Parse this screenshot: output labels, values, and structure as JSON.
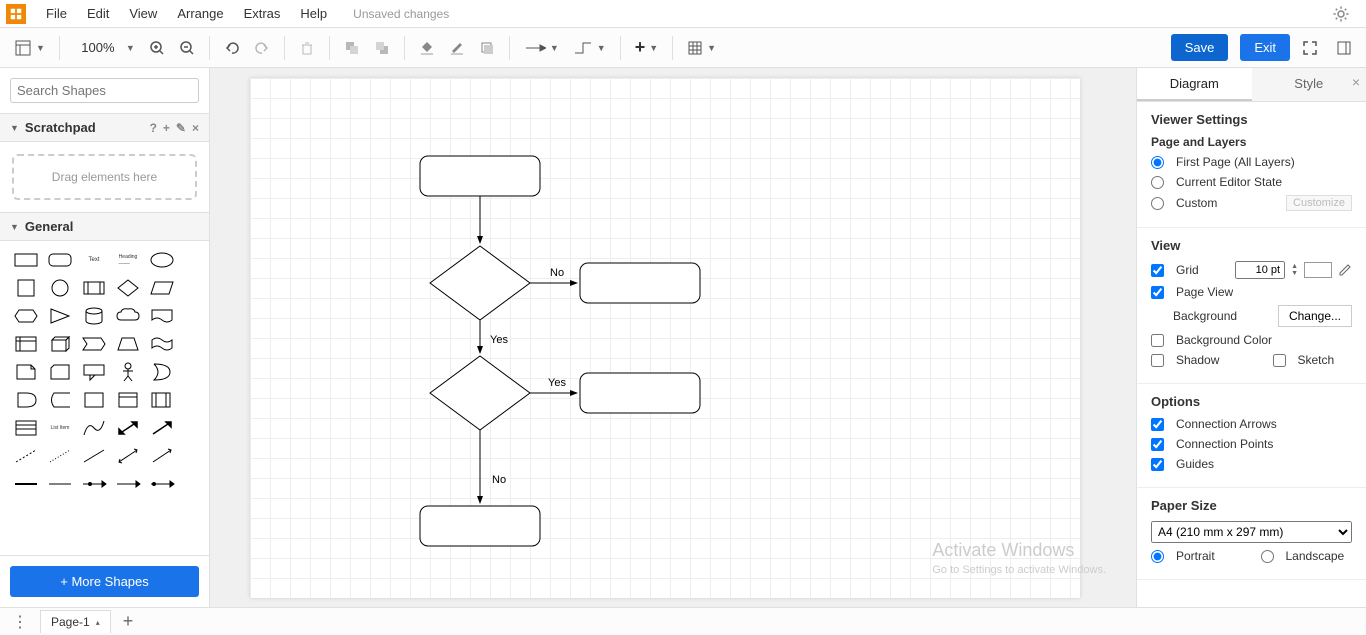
{
  "menubar": {
    "items": [
      "File",
      "Edit",
      "View",
      "Arrange",
      "Extras",
      "Help"
    ],
    "status": "Unsaved changes"
  },
  "toolbar": {
    "zoom": "100%",
    "save": "Save",
    "exit": "Exit"
  },
  "sidebar": {
    "search_placeholder": "Search Shapes",
    "scratchpad_title": "Scratchpad",
    "scratchpad_hint": "Drag elements here",
    "general_title": "General",
    "more_shapes": "+ More Shapes"
  },
  "canvas": {
    "edge_labels": {
      "no1": "No",
      "yes1": "Yes",
      "yes2": "Yes",
      "no2": "No"
    }
  },
  "rightpanel": {
    "tabs": {
      "diagram": "Diagram",
      "style": "Style"
    },
    "viewer_settings": "Viewer Settings",
    "page_layers": "Page and Layers",
    "first_page": "First Page (All Layers)",
    "current_editor": "Current Editor State",
    "custom": "Custom",
    "customize": "Customize",
    "view": "View",
    "grid": "Grid",
    "grid_size": "10 pt",
    "page_view": "Page View",
    "background": "Background",
    "change": "Change...",
    "bg_color": "Background Color",
    "shadow": "Shadow",
    "sketch": "Sketch",
    "options": "Options",
    "conn_arrows": "Connection Arrows",
    "conn_points": "Connection Points",
    "guides": "Guides",
    "paper_size": "Paper Size",
    "paper_value": "A4 (210 mm x 297 mm)",
    "portrait": "Portrait",
    "landscape": "Landscape"
  },
  "bottombar": {
    "page_label": "Page-1"
  },
  "watermark": {
    "line1": "Activate Windows",
    "line2": "Go to Settings to activate Windows."
  }
}
